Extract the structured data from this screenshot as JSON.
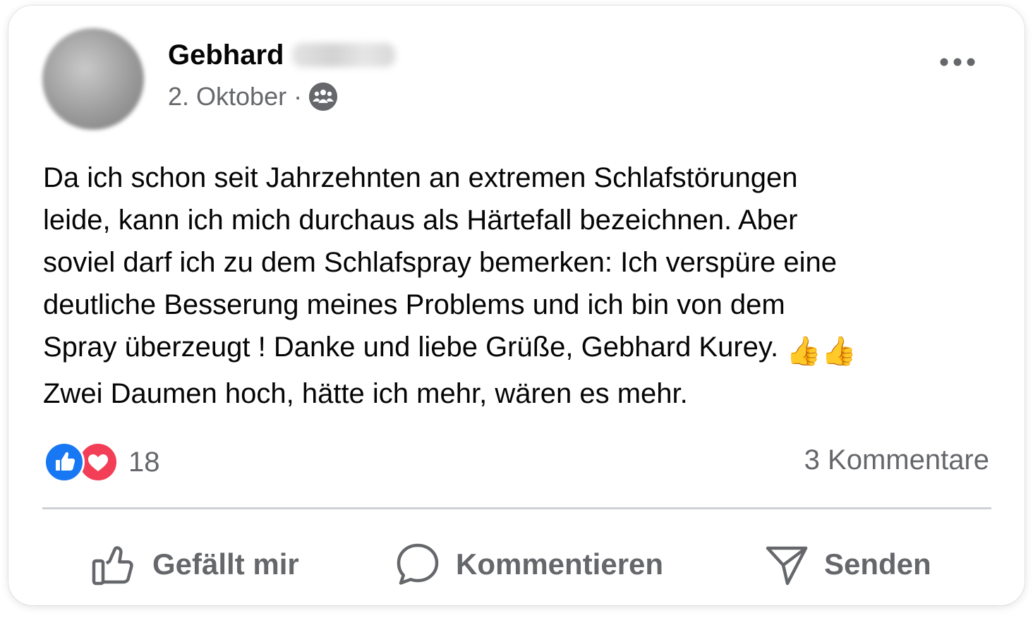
{
  "post": {
    "author_first_name": "Gebhard",
    "date": "2. Oktober",
    "separator": "·",
    "audience_icon": "group-icon",
    "body_lines": [
      "Da ich schon seit Jahrzehnten an extremen Schlafstörungen",
      "leide, kann ich mich durchaus als Härtefall bezeichnen. Aber",
      "soviel darf ich zu dem Schlafspray bemerken: Ich verspüre eine",
      "deutliche Besserung meines Problems und ich bin von dem",
      "Spray überzeugt ! Danke und liebe Grüße, Gebhard Kurey.",
      "Zwei Daumen hoch, hätte ich mehr, wären es mehr."
    ],
    "inline_emoji": "👍👍"
  },
  "reactions": {
    "icons": [
      "like-icon",
      "love-icon"
    ],
    "count": "18",
    "comments": "3 Kommentare"
  },
  "actions": {
    "like_label": "Gefällt mir",
    "comment_label": "Kommentieren",
    "send_label": "Senden"
  },
  "colors": {
    "text": "#050505",
    "secondary": "#65676b",
    "like_blue": "#1877f2",
    "love_red": "#f33e58",
    "divider": "#ced0d4"
  }
}
